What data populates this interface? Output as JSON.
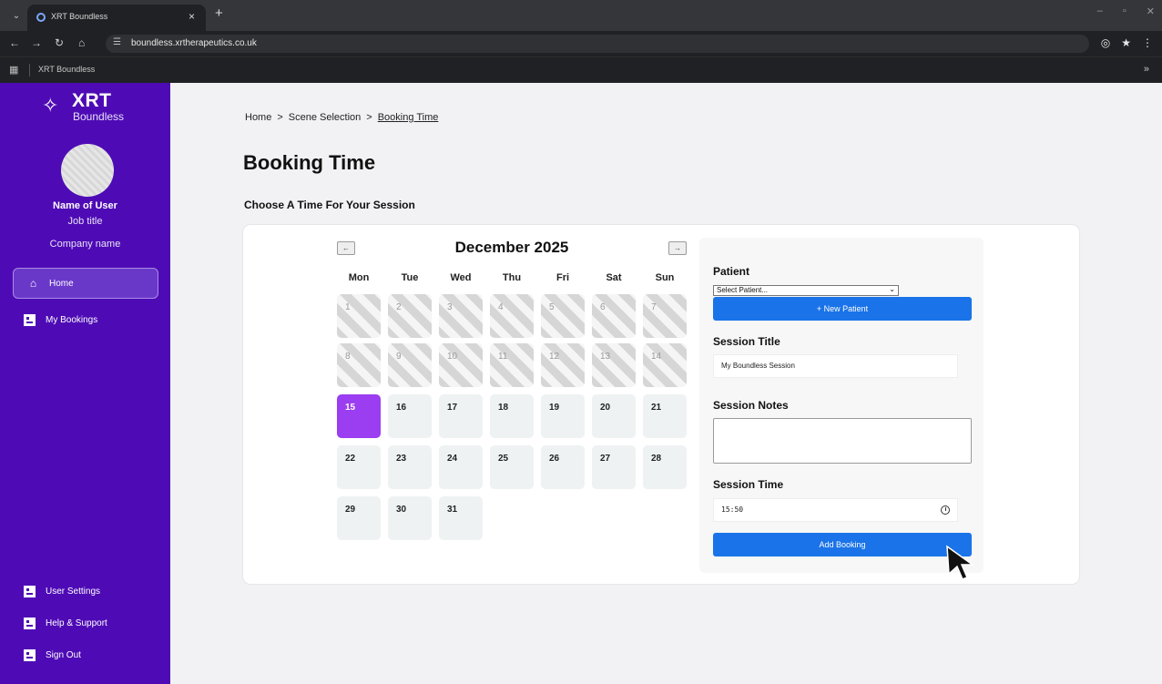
{
  "browser": {
    "tab_title": "XRT Boundless",
    "new_tab": "+",
    "tab_close": "×",
    "url": "boundless.xrtherapeutics.co.uk",
    "bookmark": "XRT Boundless",
    "more": "»"
  },
  "sidebar": {
    "logo_text": "XRT",
    "logo_sub": "Boundless",
    "user_name": "Name of User",
    "job_title": "Job title",
    "company": "Company name",
    "nav": [
      {
        "label": "Home"
      },
      {
        "label": "My Bookings"
      }
    ],
    "bottom_nav": [
      {
        "label": "User Settings"
      },
      {
        "label": "Help & Support"
      },
      {
        "label": "Sign Out"
      }
    ]
  },
  "main": {
    "breadcrumb": [
      "Home",
      ">",
      "Scene Selection",
      ">",
      "Booking Time"
    ],
    "title": "Booking Time",
    "subtitle": "Choose A Time For Your Session"
  },
  "calendar": {
    "month_title": "December 2025",
    "prev": "←",
    "next": "→",
    "weekdays": [
      "Mon",
      "Tue",
      "Wed",
      "Thu",
      "Fri",
      "Sat",
      "Sun"
    ],
    "days": [
      "1",
      "2",
      "3",
      "4",
      "5",
      "6",
      "7",
      "8",
      "9",
      "10",
      "11",
      "12",
      "13",
      "14",
      "15",
      "16",
      "17",
      "18",
      "19",
      "20",
      "21",
      "22",
      "23",
      "24",
      "25",
      "26",
      "27",
      "28",
      "29",
      "30",
      "31"
    ],
    "selected_day": 15,
    "first_available_day": 15
  },
  "form": {
    "patient_label": "Patient",
    "patient_select": "Select Patient...",
    "new_patient_button": "+ New Patient",
    "session_title_label": "Session Title",
    "session_title_value": "My Boundless Session",
    "session_notes_label": "Session Notes",
    "session_notes_value": "",
    "session_time_label": "Session Time",
    "session_time_value": "15:50",
    "add_booking_button": "Add Booking"
  },
  "colors": {
    "sidebar": "#4e0bb5",
    "selected_day": "#9b3df0",
    "primary_button": "#1a73e8"
  }
}
